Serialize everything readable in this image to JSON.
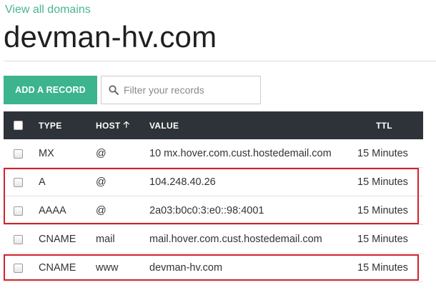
{
  "nav": {
    "back_link": "View all domains"
  },
  "page": {
    "title": "devman-hv.com"
  },
  "toolbar": {
    "add_record_label": "ADD A RECORD",
    "filter_placeholder": "Filter your records"
  },
  "table": {
    "columns": {
      "type": "TYPE",
      "host": "HOST",
      "value": "VALUE",
      "ttl": "TTL"
    },
    "sort": {
      "column": "host",
      "direction": "ascending"
    },
    "rows": [
      {
        "type": "MX",
        "host": "@",
        "value": "10 mx.hover.com.cust.hostedemail.com",
        "ttl": "15 Minutes",
        "highlighted": false
      },
      {
        "type": "A",
        "host": "@",
        "value": "104.248.40.26",
        "ttl": "15 Minutes",
        "highlighted": true
      },
      {
        "type": "AAAA",
        "host": "@",
        "value": "2a03:b0c0:3:e0::98:4001",
        "ttl": "15 Minutes",
        "highlighted": true
      },
      {
        "type": "CNAME",
        "host": "mail",
        "value": "mail.hover.com.cust.hostedemail.com",
        "ttl": "15 Minutes",
        "highlighted": false
      },
      {
        "type": "CNAME",
        "host": "www",
        "value": "devman-hv.com",
        "ttl": "15 Minutes",
        "highlighted": true
      }
    ]
  },
  "colors": {
    "accent": "#3cb48e",
    "link": "#4bb58c",
    "header_bg": "#2d3338",
    "highlight": "#d0232d"
  },
  "icons": {
    "search": "search-icon",
    "sort": "sort-ascending-icon"
  }
}
